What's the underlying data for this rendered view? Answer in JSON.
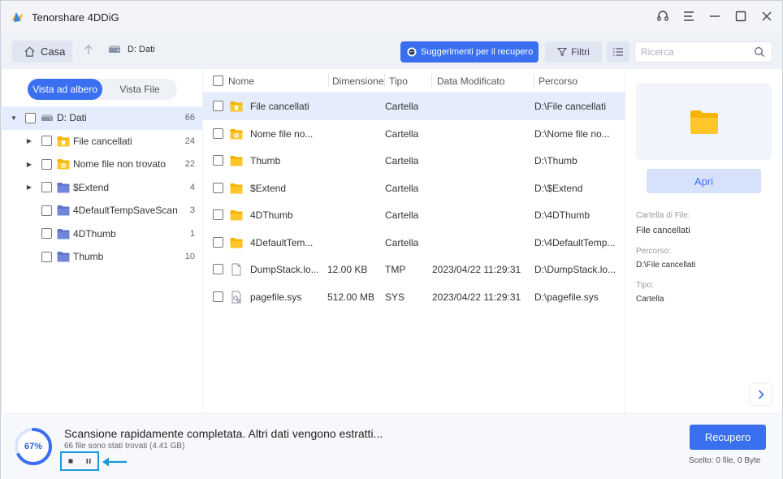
{
  "app": {
    "title": "Tenorshare 4DDiG"
  },
  "window_controls": [
    "headset-icon",
    "menu-icon",
    "minimize-icon",
    "maximize-icon",
    "close-icon"
  ],
  "toolbar": {
    "home_label": "Casa",
    "drive_label": "D: Dati",
    "suggest_label": "Suggerimenti per il recupero",
    "filter_label": "Filtri",
    "search_placeholder": "Ricerca"
  },
  "view_toggle": {
    "tree": "Vista ad albero",
    "file": "Vista File",
    "active": "tree"
  },
  "tree": [
    {
      "label": "D: Dati",
      "count": "66",
      "icon": "drive-icon",
      "level": 0,
      "expanded": true,
      "selected": true
    },
    {
      "label": "File cancellati",
      "count": "24",
      "icon": "deleted-folder-icon",
      "level": 1,
      "has_children": true
    },
    {
      "label": "Nome file non trovato",
      "count": "22",
      "icon": "lost-folder-icon",
      "level": 1,
      "has_children": true
    },
    {
      "label": "$Extend",
      "count": "4",
      "icon": "folder-icon",
      "level": 1,
      "has_children": true
    },
    {
      "label": "4DefaultTempSaveScan",
      "count": "3",
      "icon": "folder-icon",
      "level": 1,
      "has_children": false
    },
    {
      "label": "4DThumb",
      "count": "1",
      "icon": "folder-icon",
      "level": 1,
      "has_children": false
    },
    {
      "label": "Thumb",
      "count": "10",
      "icon": "folder-icon",
      "level": 1,
      "has_children": false
    }
  ],
  "table": {
    "columns": {
      "name": "Nome",
      "size": "Dimensione",
      "type": "Tipo",
      "modified": "Data Modificato",
      "path": "Percorso"
    },
    "rows": [
      {
        "name": "File cancellati",
        "size": "",
        "type": "Cartella",
        "modified": "",
        "path": "D:\\File cancellati",
        "icon": "deleted-folder-icon",
        "selected": true
      },
      {
        "name": "Nome file no...",
        "size": "",
        "type": "Cartella",
        "modified": "",
        "path": "D:\\Nome file no...",
        "icon": "lost-folder-icon"
      },
      {
        "name": "Thumb",
        "size": "",
        "type": "Cartella",
        "modified": "",
        "path": "D:\\Thumb",
        "icon": "folder-icon"
      },
      {
        "name": "$Extend",
        "size": "",
        "type": "Cartella",
        "modified": "",
        "path": "D:\\$Extend",
        "icon": "folder-icon"
      },
      {
        "name": "4DThumb",
        "size": "",
        "type": "Cartella",
        "modified": "",
        "path": "D:\\4DThumb",
        "icon": "folder-icon"
      },
      {
        "name": "4DefaultTem...",
        "size": "",
        "type": "Cartella",
        "modified": "",
        "path": "D:\\4DefaultTemp...",
        "icon": "folder-icon"
      },
      {
        "name": "DumpStack.lo...",
        "size": "12.00 KB",
        "type": "TMP",
        "modified": "2023/04/22 11:29:31",
        "path": "D:\\DumpStack.lo...",
        "icon": "file-icon"
      },
      {
        "name": "pagefile.sys",
        "size": "512.00 MB",
        "type": "SYS",
        "modified": "2023/04/22 11:29:31",
        "path": "D:\\pagefile.sys",
        "icon": "system-file-icon"
      }
    ]
  },
  "details": {
    "open_label": "Apri",
    "folder_label": "Cartella di File:",
    "folder_value": "File cancellati",
    "path_label": "Percorso:",
    "path_value": "D:\\File cancellati",
    "type_label": "Tipo:",
    "type_value": "Cartella"
  },
  "status": {
    "progress_percent": 67,
    "progress_text": "67%",
    "message": "Scansione rapidamente completata. Altri dati vengono estratti...",
    "found": "66 file sono stati trovati (4.41 GB)",
    "recover_label": "Recupero",
    "selection": "Scelto: 0 file, 0 Byte"
  },
  "colors": {
    "accent": "#3a6ff0",
    "folder": "#f5b400",
    "highlight": "#1a9ad6",
    "selected_row": "#e5ecfb"
  }
}
